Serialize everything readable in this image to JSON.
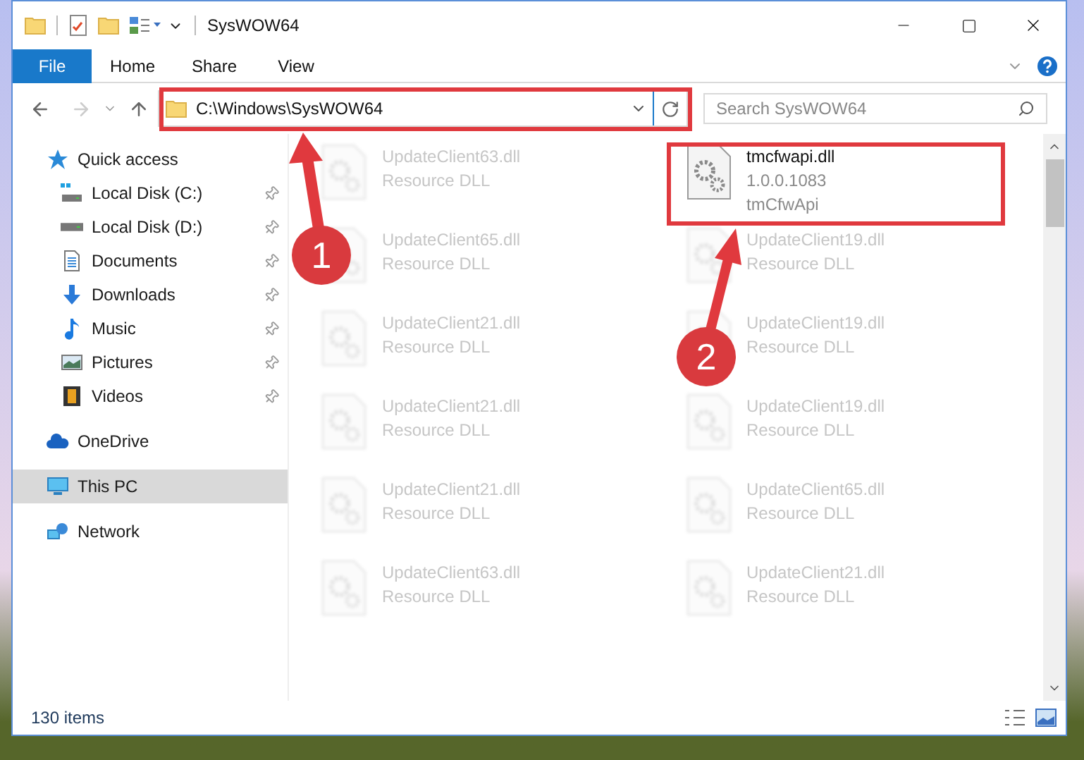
{
  "window": {
    "title": "SysWOW64"
  },
  "ribbon_tabs": [
    {
      "label": "File",
      "selected": true
    },
    {
      "label": "Home",
      "selected": false
    },
    {
      "label": "Share",
      "selected": false
    },
    {
      "label": "View",
      "selected": false
    }
  ],
  "address": {
    "path": "C:\\Windows\\SysWOW64"
  },
  "search": {
    "placeholder": "Search SysWOW64"
  },
  "sidebar": {
    "items": [
      {
        "label": "Quick access",
        "kind": "star",
        "selected": false,
        "children": [
          {
            "label": "Local Disk (C:)",
            "kind": "drive_c",
            "pinned": true
          },
          {
            "label": "Local Disk (D:)",
            "kind": "drive",
            "pinned": true
          },
          {
            "label": "Documents",
            "kind": "documents",
            "pinned": true
          },
          {
            "label": "Downloads",
            "kind": "downloads",
            "pinned": true
          },
          {
            "label": "Music",
            "kind": "music",
            "pinned": true
          },
          {
            "label": "Pictures",
            "kind": "pictures",
            "pinned": true
          },
          {
            "label": "Videos",
            "kind": "videos",
            "pinned": true
          }
        ]
      },
      {
        "label": "OneDrive",
        "kind": "cloud",
        "selected": false
      },
      {
        "label": "This PC",
        "kind": "pc",
        "selected": true
      },
      {
        "label": "Network",
        "kind": "network",
        "selected": false
      }
    ]
  },
  "files": [
    {
      "name": "UpdateClient63.dll",
      "lines": [
        "Resource DLL"
      ],
      "blurred": true
    },
    {
      "name": "tmcfwapi.dll",
      "lines": [
        "1.0.0.1083",
        "tmCfwApi"
      ],
      "blurred": false
    },
    {
      "name": "UpdateClient65.dll",
      "lines": [
        "Resource DLL"
      ],
      "blurred": true
    },
    {
      "name": "UpdateClient19.dll",
      "lines": [
        "Resource DLL"
      ],
      "blurred": true
    },
    {
      "name": "UpdateClient21.dll",
      "lines": [
        "Resource DLL"
      ],
      "blurred": true
    },
    {
      "name": "UpdateClient19.dll",
      "lines": [
        "Resource DLL"
      ],
      "blurred": true
    },
    {
      "name": "UpdateClient21.dll",
      "lines": [
        "Resource DLL"
      ],
      "blurred": true
    },
    {
      "name": "UpdateClient19.dll",
      "lines": [
        "Resource DLL"
      ],
      "blurred": true
    },
    {
      "name": "UpdateClient21.dll",
      "lines": [
        "Resource DLL"
      ],
      "blurred": true
    },
    {
      "name": "UpdateClient65.dll",
      "lines": [
        "Resource DLL"
      ],
      "blurred": true
    },
    {
      "name": "UpdateClient63.dll",
      "lines": [
        "Resource DLL"
      ],
      "blurred": true
    },
    {
      "name": "UpdateClient21.dll",
      "lines": [
        "Resource DLL"
      ],
      "blurred": true
    }
  ],
  "status_bar": {
    "count": "130 items"
  },
  "annotations": [
    {
      "number": "1"
    },
    {
      "number": "2"
    }
  ]
}
